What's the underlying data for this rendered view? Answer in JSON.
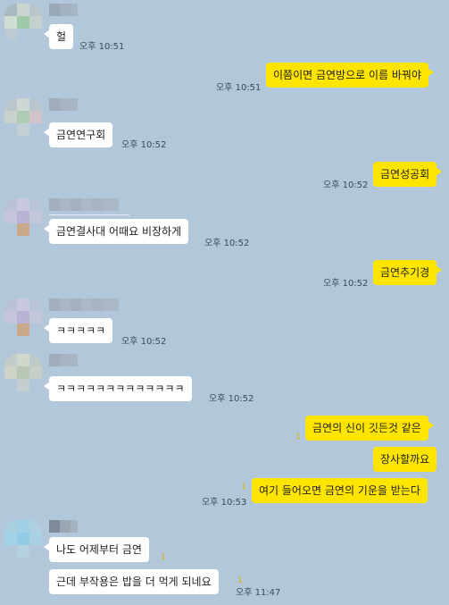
{
  "messages": [
    {
      "text": "헐",
      "time": "오후 10:51"
    },
    {
      "text": "이쯤이면 금연방으로 이름 바꿔야",
      "time": "오후 10:51"
    },
    {
      "text": "금연연구회",
      "time": "오후 10:52"
    },
    {
      "text": "금연성공회",
      "time": "오후 10:52"
    },
    {
      "text": "금연결사대 어때요 비장하게",
      "time": "오후 10:52"
    },
    {
      "text": "금연추기경",
      "time": "오후 10:52"
    },
    {
      "text": "ㅋㅋㅋㅋㅋ",
      "time": "오후 10:52"
    },
    {
      "text": "ㅋㅋㅋㅋㅋㅋㅋㅋㅋㅋㅋㅋㅋ",
      "time": "오후 10:52"
    },
    {
      "text": "금연의 신이 깃든것 같은",
      "unread": "1"
    },
    {
      "text": "장사할까요"
    },
    {
      "text": "여기 들어오면 금연의 기운을 받는다",
      "time": "오후 10:53",
      "unread": "1"
    },
    {
      "text": "나도 어제부터 금연",
      "unread": "1"
    },
    {
      "text": "근데 부작용은 밥을 더 먹게 되네요",
      "time": "오후 11:47",
      "unread": "1"
    }
  ],
  "colors": {
    "background": "#b2c7da",
    "incoming_bubble": "#ffffff",
    "outgoing_bubble": "#fee500",
    "unread_count": "#e0b000"
  }
}
